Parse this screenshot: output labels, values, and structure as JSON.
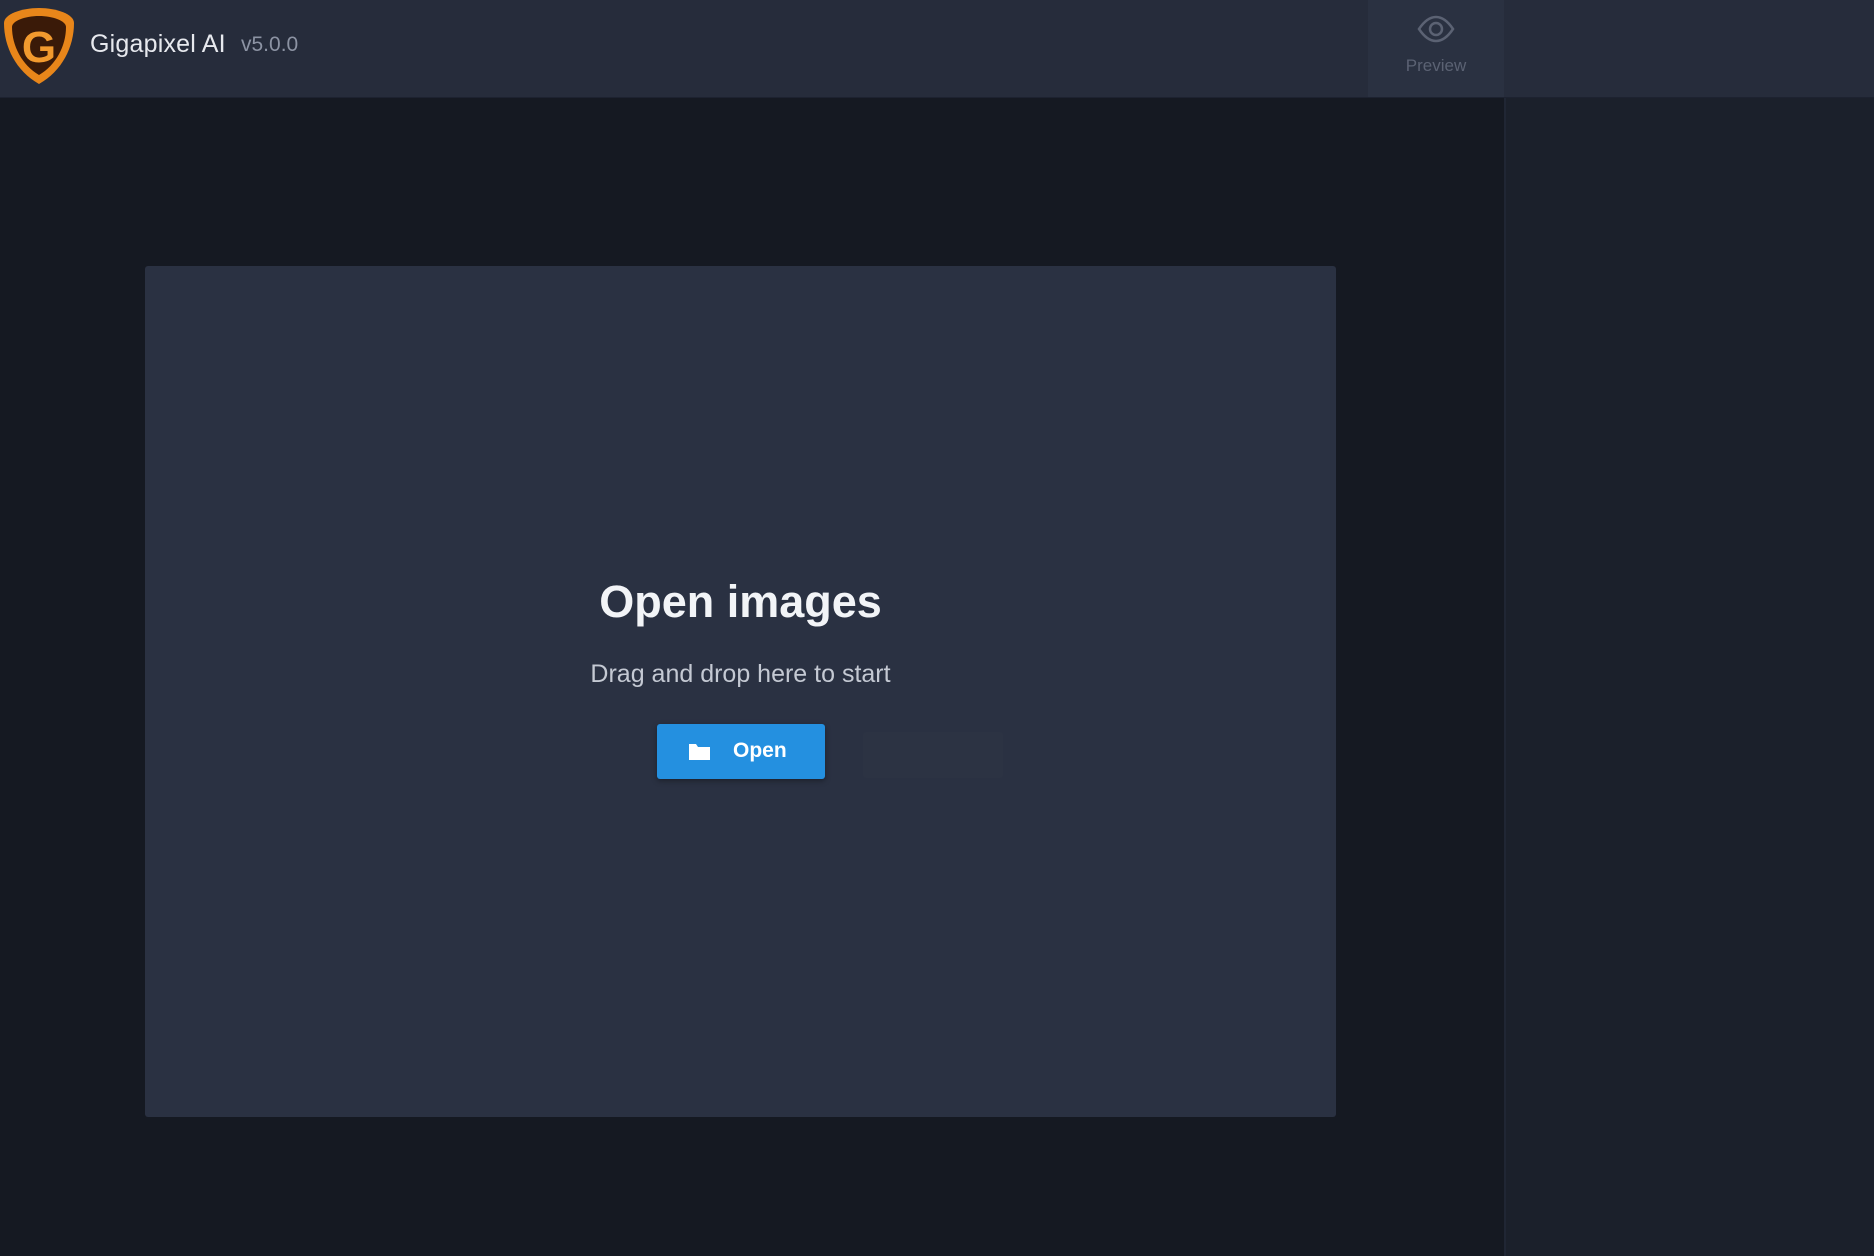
{
  "header": {
    "app_name": "Gigapixel AI",
    "version": "v5.0.0",
    "logo_icon": "gigapixel-g-logo",
    "preview": {
      "label": "Preview",
      "icon": "eye-icon"
    }
  },
  "dropzone": {
    "title": "Open images",
    "subtitle": "Drag and drop here to start",
    "open_button": {
      "label": "Open",
      "icon": "folder-icon"
    }
  },
  "colors": {
    "accent": "#2490e0",
    "logo_orange": "#e8861a",
    "topbar": "#262c3b",
    "background": "#151922",
    "panel": "#2a3142"
  }
}
